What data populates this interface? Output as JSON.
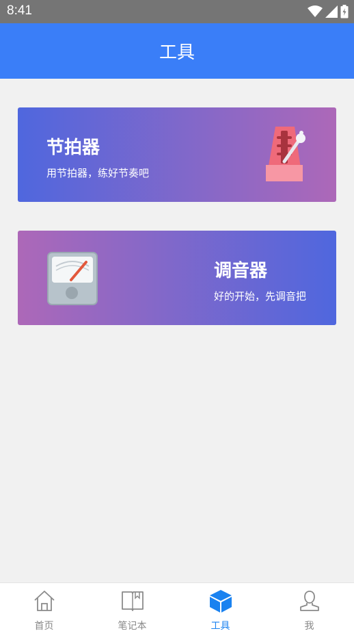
{
  "status_bar": {
    "time": "8:41",
    "icons": [
      "wifi-icon",
      "signal-icon",
      "battery-icon"
    ]
  },
  "header": {
    "title": "工具"
  },
  "cards": [
    {
      "title": "节拍器",
      "subtitle": "用节拍器，练好节奏吧",
      "icon": "metronome-icon"
    },
    {
      "title": "调音器",
      "subtitle": "好的开始，先调音把",
      "icon": "tuner-gauge-icon"
    }
  ],
  "bottom_nav": {
    "items": [
      {
        "label": "首页",
        "icon": "home-icon",
        "active": false
      },
      {
        "label": "笔记本",
        "icon": "notebook-icon",
        "active": false
      },
      {
        "label": "工具",
        "icon": "cube-icon",
        "active": true
      },
      {
        "label": "我",
        "icon": "user-icon",
        "active": false
      }
    ]
  },
  "colors": {
    "header": "#3a7ef8",
    "active_tab": "#1a82f0",
    "background": "#f1f1f1"
  }
}
